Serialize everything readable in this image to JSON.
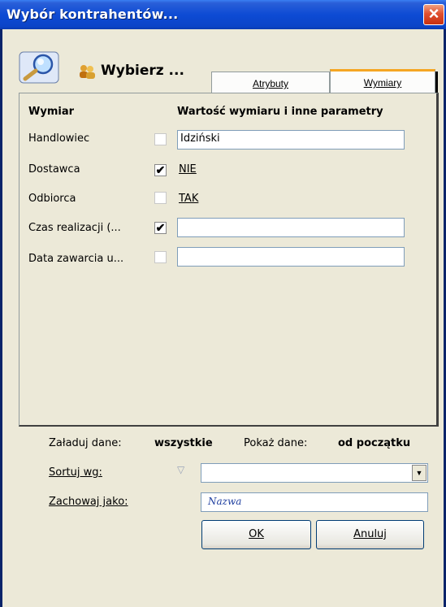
{
  "window": {
    "title": "Wybór kontrahentów..."
  },
  "toolbar": {
    "label": "Wybierz ..."
  },
  "tabs": [
    {
      "label": "Atrybuty",
      "active": false
    },
    {
      "label": "Wymiary",
      "active": true
    }
  ],
  "table": {
    "header_left": "Wymiar",
    "header_right": "Wartość wymiaru i inne parametry",
    "rows": [
      {
        "label": "Handlowiec",
        "checked": false,
        "value": "Idziński",
        "type": "input"
      },
      {
        "label": "Dostawca",
        "checked": true,
        "value": "NIE",
        "type": "link"
      },
      {
        "label": "Odbiorca",
        "checked": false,
        "value": "TAK",
        "type": "link"
      },
      {
        "label": "Czas realizacji (...",
        "checked": true,
        "value": "",
        "type": "input"
      },
      {
        "label": "Data zawarcia u...",
        "checked": false,
        "value": "",
        "type": "input"
      }
    ]
  },
  "load": {
    "label": "Załaduj dane:",
    "value": "wszystkie"
  },
  "show": {
    "label": "Pokaż dane:",
    "value": "od początku"
  },
  "sort": {
    "label": "Sortuj wg:",
    "value": ""
  },
  "save_as": {
    "label": "Zachowaj jako:",
    "placeholder": "Nazwa"
  },
  "buttons": {
    "ok": "OK",
    "cancel": "Anuluj"
  },
  "icons": {
    "close": "close-icon",
    "search": "magnifier-icon",
    "users": "users-icon",
    "filter": "filter-icon",
    "dropdown": "chevron-down-icon"
  },
  "colors": {
    "titlebar": "#0b44c8",
    "dialog_bg": "#ece9d8",
    "tab_accent": "#f5a623",
    "input_border": "#7f9db9"
  }
}
